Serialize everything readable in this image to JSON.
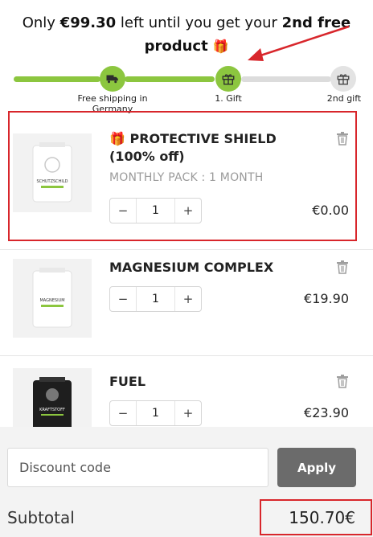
{
  "banner": {
    "prefix": "Only ",
    "amount": "€99.30",
    "middle": " left until you get your ",
    "goal_bold": "2nd free product",
    "gift_emoji": "🎁"
  },
  "progress": {
    "fill_fraction": 0.62,
    "milestones": [
      {
        "label": "Free shipping in Germany",
        "icon": "truck-icon",
        "reached": true
      },
      {
        "label": "1. Gift",
        "icon": "gift-icon",
        "reached": true
      },
      {
        "label": "2nd gift",
        "icon": "gift-icon",
        "reached": false
      }
    ]
  },
  "cart": {
    "items": [
      {
        "gift_emoji": "🎁",
        "name": "PROTECTIVE SHIELD (100% off)",
        "variant": "MONTHLY PACK : 1 MONTH",
        "quantity": "1",
        "price": "€0.00",
        "package_text": "SCHUTZSCHILD"
      },
      {
        "name": "MAGNESIUM COMPLEX",
        "quantity": "1",
        "price": "€19.90",
        "package_text": "MAGNESIUM"
      },
      {
        "name": "FUEL",
        "quantity": "1",
        "price": "€23.90",
        "package_text": "KRAFTSTOFF"
      }
    ],
    "minus_symbol": "−",
    "plus_symbol": "+"
  },
  "discount": {
    "placeholder": "Discount code",
    "apply_label": "Apply"
  },
  "summary": {
    "subtotal_label": "Subtotal",
    "subtotal_value": "150.70€"
  },
  "colors": {
    "accent_green": "#8cc63f",
    "highlight_red": "#d8262b",
    "button_grey": "#6b6b6b"
  }
}
